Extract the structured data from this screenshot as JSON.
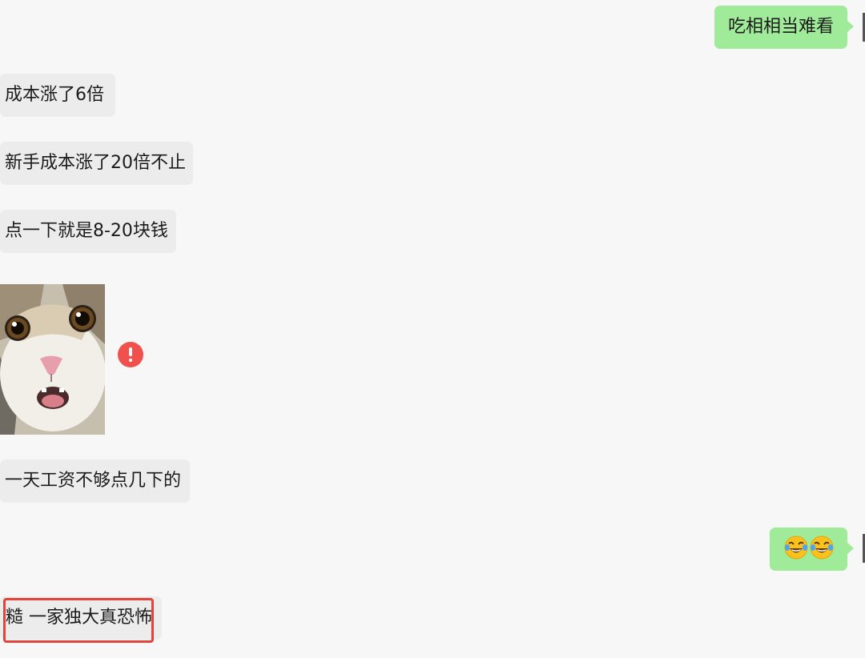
{
  "messages": [
    {
      "sender": "self",
      "type": "text",
      "text": "吃相相当难看"
    },
    {
      "sender": "other",
      "type": "text",
      "text": "成本涨了6倍"
    },
    {
      "sender": "other",
      "type": "text",
      "text": "新手成本涨了20倍不止"
    },
    {
      "sender": "other",
      "type": "text",
      "text": "点一下就是8-20块钱"
    },
    {
      "sender": "other",
      "type": "sticker",
      "sticker": "surprised-cat",
      "status": "send-failed"
    },
    {
      "sender": "other",
      "type": "text",
      "text": "一天工资不够点几下的"
    },
    {
      "sender": "self",
      "type": "emoji",
      "emoji": [
        "face-with-tears-of-joy",
        "face-with-tears-of-joy"
      ]
    },
    {
      "sender": "other",
      "type": "text",
      "text": "糙 一家独大真恐怖",
      "highlighted": true
    }
  ],
  "colors": {
    "background": "#f7f7f7",
    "incoming_bubble": "#ececec",
    "outgoing_bubble": "#a0eb99",
    "error": "#f0514d",
    "highlight_border": "#e0443c"
  },
  "icons": [
    "error-icon",
    "laughing-emoji-icon"
  ]
}
